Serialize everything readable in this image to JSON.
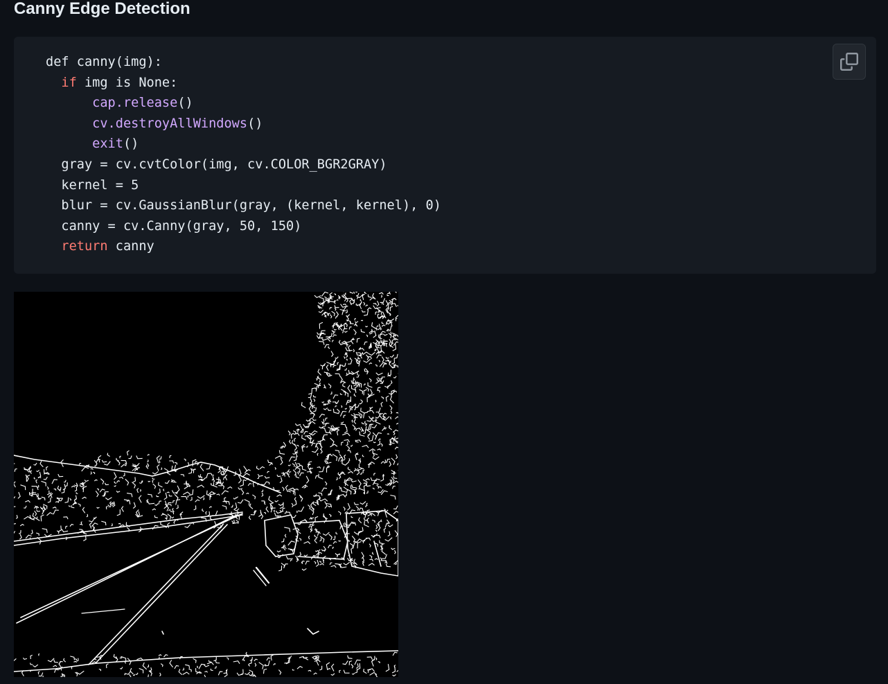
{
  "section": {
    "title": "Canny Edge Detection"
  },
  "code_block": {
    "lines": [
      [
        {
          "t": "def canny(img):",
          "c": ""
        }
      ],
      [
        {
          "t": "  ",
          "c": ""
        },
        {
          "t": "if",
          "c": "kw"
        },
        {
          "t": " img is None:",
          "c": ""
        }
      ],
      [
        {
          "t": "      ",
          "c": ""
        },
        {
          "t": "cap.release",
          "c": "fn"
        },
        {
          "t": "()",
          "c": ""
        }
      ],
      [
        {
          "t": "      ",
          "c": ""
        },
        {
          "t": "cv.destroyAllWindows",
          "c": "fn"
        },
        {
          "t": "()",
          "c": ""
        }
      ],
      [
        {
          "t": "      ",
          "c": ""
        },
        {
          "t": "exit",
          "c": "fn"
        },
        {
          "t": "()",
          "c": ""
        }
      ],
      [
        {
          "t": "  gray = cv.cvtColor(img, cv.COLOR_BGR2GRAY)",
          "c": ""
        }
      ],
      [
        {
          "t": "  kernel = 5",
          "c": ""
        }
      ],
      [
        {
          "t": "  blur = cv.GaussianBlur(gray, (kernel, kernel), 0)",
          "c": ""
        }
      ],
      [
        {
          "t": "  canny = cv.Canny(gray, 50, 150)",
          "c": ""
        }
      ],
      [
        {
          "t": "  ",
          "c": ""
        },
        {
          "t": "return",
          "c": "kw"
        },
        {
          "t": " canny",
          "c": ""
        }
      ]
    ],
    "copy_icon": "copy-icon"
  },
  "image": {
    "description_icon": "canny-edge-output-image"
  },
  "colors": {
    "page_bg": "#0d1117",
    "code_bg": "#161b22",
    "keyword": "#ff7b72",
    "function": "#d2a8ff",
    "text": "#e6edf3"
  }
}
